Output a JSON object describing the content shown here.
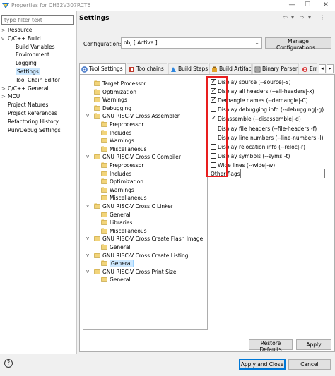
{
  "window": {
    "title": "Properties for CH32V307RCT6",
    "minimize_label": "—",
    "maximize_label": "☐",
    "close_label": "✕"
  },
  "filter": {
    "placeholder": "type filter text"
  },
  "nav": [
    {
      "label": "Resource",
      "expander": ">"
    },
    {
      "label": "C/C++ Build",
      "expander": "v"
    },
    {
      "label": "Build Variables",
      "expander": ""
    },
    {
      "label": "Environment",
      "expander": ""
    },
    {
      "label": "Logging",
      "expander": ""
    },
    {
      "label": "Settings",
      "expander": ""
    },
    {
      "label": "Tool Chain Editor",
      "expander": ""
    },
    {
      "label": "C/C++ General",
      "expander": ">"
    },
    {
      "label": "MCU",
      "expander": ">"
    },
    {
      "label": "Project Natures",
      "expander": ""
    },
    {
      "label": "Project References",
      "expander": ""
    },
    {
      "label": "Refactoring History",
      "expander": ""
    },
    {
      "label": "Run/Debug Settings",
      "expander": ""
    }
  ],
  "header": {
    "title": "Settings",
    "back_icon": "⇦",
    "menu_icon": "▾",
    "forward_icon": "⇨",
    "more_icon": "⋮"
  },
  "configuration": {
    "label": "Configuration:",
    "value": "obj  [ Active ]",
    "chevron": "⌄",
    "manage_button": "Manage Configurations..."
  },
  "tabs": [
    {
      "label": "Tool Settings",
      "icon_color": "#3a6fc4"
    },
    {
      "label": "Toolchains",
      "icon_color": "#c0392b"
    },
    {
      "label": "Build Steps",
      "icon_color": "#2e86de"
    },
    {
      "label": "Build Artifact",
      "icon_color": "#e1a32b"
    },
    {
      "label": "Binary Parsers",
      "icon_color": "#555555"
    },
    {
      "label": "Err",
      "icon_color": "#d63031"
    }
  ],
  "tab_scroll": {
    "left": "◂",
    "right": "▸"
  },
  "tree": [
    {
      "label": "Target Processor",
      "expander": ""
    },
    {
      "label": "Optimization",
      "expander": ""
    },
    {
      "label": "Warnings",
      "expander": ""
    },
    {
      "label": "Debugging",
      "expander": ""
    },
    {
      "label": "GNU RISC-V Cross Assembler",
      "expander": "v"
    },
    {
      "label": "Preprocessor",
      "expander": ""
    },
    {
      "label": "Includes",
      "expander": ""
    },
    {
      "label": "Warnings",
      "expander": ""
    },
    {
      "label": "Miscellaneous",
      "expander": ""
    },
    {
      "label": "GNU RISC-V Cross C Compiler",
      "expander": "v"
    },
    {
      "label": "Preprocessor",
      "expander": ""
    },
    {
      "label": "Includes",
      "expander": ""
    },
    {
      "label": "Optimization",
      "expander": ""
    },
    {
      "label": "Warnings",
      "expander": ""
    },
    {
      "label": "Miscellaneous",
      "expander": ""
    },
    {
      "label": "GNU RISC-V Cross C Linker",
      "expander": "v"
    },
    {
      "label": "General",
      "expander": ""
    },
    {
      "label": "Libraries",
      "expander": ""
    },
    {
      "label": "Miscellaneous",
      "expander": ""
    },
    {
      "label": "GNU RISC-V Cross Create Flash Image",
      "expander": "v"
    },
    {
      "label": "General",
      "expander": ""
    },
    {
      "label": "GNU RISC-V Cross Create Listing",
      "expander": "v"
    },
    {
      "label": "General",
      "expander": ""
    },
    {
      "label": "GNU RISC-V Cross Print Size",
      "expander": "v"
    },
    {
      "label": "General",
      "expander": ""
    }
  ],
  "options": [
    {
      "label": "Display source (--source|-S)",
      "checked": true
    },
    {
      "label": "Display all headers (--all-headers|-x)",
      "checked": true
    },
    {
      "label": "Demangle names (--demangle|-C)",
      "checked": true
    },
    {
      "label": "Display debugging info (--debugging|-g)",
      "checked": false
    },
    {
      "label": "Disassemble (--disassemble|-d)",
      "checked": true
    },
    {
      "label": "Display file headers (--file-headers|-f)",
      "checked": false
    },
    {
      "label": "Display line numbers (--line-numbers|-l)",
      "checked": false
    },
    {
      "label": "Display relocation info (--reloc|-r)",
      "checked": false
    },
    {
      "label": "Display symbols (--syms|-t)",
      "checked": false
    },
    {
      "label": "Wide lines (--wide|-w)",
      "checked": false
    }
  ],
  "other_flags": {
    "label": "Other flags",
    "value": ""
  },
  "buttons": {
    "restore_defaults": "Restore Defaults",
    "apply": "Apply",
    "apply_and_close": "Apply and Close",
    "cancel": "Cancel"
  },
  "help": {
    "label": "?"
  },
  "colors": {
    "highlight": "#e81e1e",
    "selection": "#cce8ff",
    "primary_border": "#0078d7"
  }
}
